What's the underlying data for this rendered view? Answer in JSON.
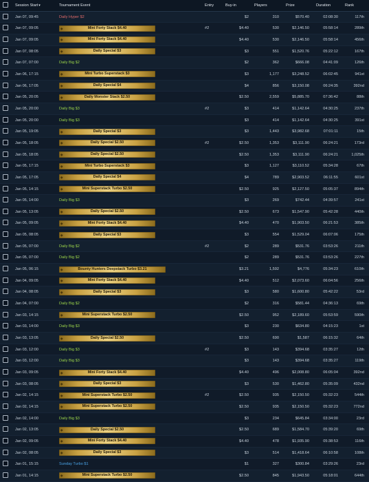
{
  "header": {
    "session_start": "Session Start",
    "tournament_event": "Tournament Event",
    "entry": "Entry",
    "buy_in": "Buy-in",
    "players": "Players",
    "prize": "Prize",
    "duration": "Duration",
    "rank": "Rank"
  },
  "colors": {
    "hyper": "#e06a6a",
    "big": "#9bd44a",
    "sunday": "#4aa3e6",
    "badge_gold": "#d4b04f"
  },
  "rows": [
    {
      "date": "Jan 07, 09:45",
      "event": "Daily Hyper $2",
      "style": "hyper",
      "entry": "",
      "buyin": "$2",
      "players": "310",
      "prize": "$570.40",
      "duration": "02:08:30",
      "rank": "117th"
    },
    {
      "date": "Jan 07, 09:05",
      "event": "Mini Forty Stack $4.40",
      "style": "badge",
      "entry": "#2",
      "buyin": "$4.40",
      "players": "530",
      "prize": "$2,146.50",
      "duration": "05:58:14",
      "rank": "289th"
    },
    {
      "date": "Jan 07, 09:05",
      "event": "Mini Forty Stack $4.40",
      "style": "badge",
      "entry": "",
      "buyin": "$4.40",
      "players": "530",
      "prize": "$2,146.50",
      "duration": "05:58:14",
      "rank": "456th"
    },
    {
      "date": "Jan 07, 08:05",
      "event": "Daily Special $3",
      "style": "badge",
      "entry": "",
      "buyin": "$3",
      "players": "551",
      "prize": "$1,520.76",
      "duration": "05:22:12",
      "rank": "167th"
    },
    {
      "date": "Jan 07, 07:00",
      "event": "Daily Big $2",
      "style": "big",
      "entry": "",
      "buyin": "$2",
      "players": "362",
      "prize": "$666.08",
      "duration": "04:41:09",
      "rank": "126th"
    },
    {
      "date": "Jan 06, 17:15",
      "event": "Mini Turbo Superstack $3",
      "style": "badge",
      "entry": "",
      "buyin": "$3",
      "players": "1,177",
      "prize": "$3,248.52",
      "duration": "06:02:45",
      "rank": "941st"
    },
    {
      "date": "Jan 06, 17:05",
      "event": "Daily Special $4",
      "style": "badge",
      "entry": "",
      "buyin": "$4",
      "players": "856",
      "prize": "$3,150.08",
      "duration": "06:24:35",
      "rank": "392nd"
    },
    {
      "date": "Jan 05, 20:05",
      "event": "Daily Monster Stack $2.50",
      "style": "badge",
      "entry": "",
      "buyin": "$2.50",
      "players": "2,559",
      "prize": "$5,885.70",
      "duration": "07:36:42",
      "rank": "88th"
    },
    {
      "date": "Jan 05, 20:00",
      "event": "Daily Big $3",
      "style": "big",
      "entry": "#2",
      "buyin": "$3",
      "players": "414",
      "prize": "$1,142.64",
      "duration": "04:30:25",
      "rank": "237th"
    },
    {
      "date": "Jan 05, 20:00",
      "event": "Daily Big $3",
      "style": "big",
      "entry": "",
      "buyin": "$3",
      "players": "414",
      "prize": "$1,142.64",
      "duration": "04:30:25",
      "rank": "391st"
    },
    {
      "date": "Jan 05, 19:05",
      "event": "Daily Special $3",
      "style": "badge",
      "entry": "",
      "buyin": "$3",
      "players": "1,443",
      "prize": "$3,982.68",
      "duration": "07:01:11",
      "rank": "15th"
    },
    {
      "date": "Jan 05, 18:05",
      "event": "Daily Special $2.50",
      "style": "badge",
      "entry": "#2",
      "buyin": "$2.50",
      "players": "1,353",
      "prize": "$3,111.90",
      "duration": "06:24:21",
      "rank": "173rd"
    },
    {
      "date": "Jan 05, 18:05",
      "event": "Daily Special $2.50",
      "style": "badge",
      "entry": "",
      "buyin": "$2.50",
      "players": "1,353",
      "prize": "$3,111.90",
      "duration": "06:24:21",
      "rank": "1,025th"
    },
    {
      "date": "Jan 05, 17:15",
      "event": "Mini Turbo Superstack $3",
      "style": "badge",
      "entry": "",
      "buyin": "$3",
      "players": "1,127",
      "prize": "$3,110.52",
      "duration": "05:34:28",
      "rank": "67th"
    },
    {
      "date": "Jan 05, 17:05",
      "event": "Daily Special $4",
      "style": "badge",
      "entry": "",
      "buyin": "$4",
      "players": "789",
      "prize": "$2,903.52",
      "duration": "06:11:55",
      "rank": "601st"
    },
    {
      "date": "Jan 05, 14:15",
      "event": "Mini Superstack Turbo $2.50",
      "style": "badge",
      "entry": "",
      "buyin": "$2.50",
      "players": "925",
      "prize": "$2,127.50",
      "duration": "05:05:37",
      "rank": "894th"
    },
    {
      "date": "Jan 05, 14:00",
      "event": "Daily Big $3",
      "style": "big",
      "entry": "",
      "buyin": "$3",
      "players": "269",
      "prize": "$742.44",
      "duration": "04:39:57",
      "rank": "241st"
    },
    {
      "date": "Jan 05, 13:05",
      "event": "Daily Special $2.50",
      "style": "badge",
      "entry": "",
      "buyin": "$2.50",
      "players": "673",
      "prize": "$1,547.90",
      "duration": "05:42:28",
      "rank": "440th"
    },
    {
      "date": "Jan 05, 09:05",
      "event": "Mini Forty Stack $4.40",
      "style": "badge",
      "entry": "",
      "buyin": "$4.40",
      "players": "470",
      "prize": "$1,903.50",
      "duration": "06:21:53",
      "rank": "385th"
    },
    {
      "date": "Jan 05, 08:05",
      "event": "Daily Special $3",
      "style": "badge",
      "entry": "",
      "buyin": "$3",
      "players": "554",
      "prize": "$1,529.04",
      "duration": "06:07:06",
      "rank": "175th"
    },
    {
      "date": "Jan 05, 07:00",
      "event": "Daily Big $2",
      "style": "big",
      "entry": "#2",
      "buyin": "$2",
      "players": "289",
      "prize": "$531.76",
      "duration": "03:53:26",
      "rank": "211th"
    },
    {
      "date": "Jan 05, 07:00",
      "event": "Daily Big $2",
      "style": "big",
      "entry": "",
      "buyin": "$2",
      "players": "289",
      "prize": "$531.76",
      "duration": "03:53:26",
      "rank": "227th"
    },
    {
      "date": "Jan 05, 06:15",
      "event": "Bounty Hunters Deepstack Turbo $3.21",
      "style": "badge",
      "entry": "",
      "buyin": "$3.21",
      "players": "1,592",
      "prize": "$4,776",
      "duration": "05:34:23",
      "rank": "610th"
    },
    {
      "date": "Jan 04, 09:05",
      "event": "Mini Forty Stack $4.40",
      "style": "badge",
      "entry": "",
      "buyin": "$4.40",
      "players": "512",
      "prize": "$2,073.60",
      "duration": "06:04:56",
      "rank": "256th"
    },
    {
      "date": "Jan 04, 08:05",
      "event": "Daily Special $3",
      "style": "badge",
      "entry": "",
      "buyin": "$3",
      "players": "580",
      "prize": "$1,600.80",
      "duration": "05:42:22",
      "rank": "53rd"
    },
    {
      "date": "Jan 04, 07:00",
      "event": "Daily Big $2",
      "style": "big",
      "entry": "",
      "buyin": "$2",
      "players": "316",
      "prize": "$581.44",
      "duration": "04:36:13",
      "rank": "69th"
    },
    {
      "date": "Jan 03, 14:15",
      "event": "Mini Superstack Turbo $2.50",
      "style": "badge",
      "entry": "",
      "buyin": "$2.50",
      "players": "952",
      "prize": "$2,189.60",
      "duration": "05:53:59",
      "rank": "590th"
    },
    {
      "date": "Jan 03, 14:00",
      "event": "Daily Big $3",
      "style": "big",
      "entry": "",
      "buyin": "$3",
      "players": "230",
      "prize": "$634.80",
      "duration": "04:15:23",
      "rank": "1st"
    },
    {
      "date": "Jan 03, 13:05",
      "event": "Daily Special $2.50",
      "style": "badge",
      "entry": "",
      "buyin": "$2.50",
      "players": "690",
      "prize": "$1,587",
      "duration": "06:15:32",
      "rank": "64th"
    },
    {
      "date": "Jan 03, 12:00",
      "event": "Daily Big $3",
      "style": "big",
      "entry": "#2",
      "buyin": "$3",
      "players": "143",
      "prize": "$394.68",
      "duration": "03:35:27",
      "rank": "12th"
    },
    {
      "date": "Jan 03, 12:00",
      "event": "Daily Big $3",
      "style": "big",
      "entry": "",
      "buyin": "$3",
      "players": "143",
      "prize": "$394.68",
      "duration": "03:35:27",
      "rank": "119th"
    },
    {
      "date": "Jan 03, 09:05",
      "event": "Mini Forty Stack $4.40",
      "style": "badge",
      "entry": "",
      "buyin": "$4.40",
      "players": "496",
      "prize": "$2,008.80",
      "duration": "06:05:04",
      "rank": "392nd"
    },
    {
      "date": "Jan 03, 08:05",
      "event": "Daily Special $3",
      "style": "badge",
      "entry": "",
      "buyin": "$3",
      "players": "530",
      "prize": "$1,462.80",
      "duration": "05:35:09",
      "rank": "432nd"
    },
    {
      "date": "Jan 02, 14:15",
      "event": "Mini Superstack Turbo $2.50",
      "style": "badge",
      "entry": "#2",
      "buyin": "$2.50",
      "players": "935",
      "prize": "$2,150.50",
      "duration": "05:32:23",
      "rank": "544th"
    },
    {
      "date": "Jan 02, 14:15",
      "event": "Mini Superstack Turbo $2.50",
      "style": "badge",
      "entry": "",
      "buyin": "$2.50",
      "players": "935",
      "prize": "$2,150.50",
      "duration": "05:32:23",
      "rank": "772nd"
    },
    {
      "date": "Jan 02, 14:00",
      "event": "Daily Big $3",
      "style": "big",
      "entry": "",
      "buyin": "$3",
      "players": "234",
      "prize": "$645.84",
      "duration": "03:34:00",
      "rank": "23rd"
    },
    {
      "date": "Jan 02, 13:05",
      "event": "Daily Special $2.50",
      "style": "badge",
      "entry": "",
      "buyin": "$2.50",
      "players": "689",
      "prize": "$1,584.70",
      "duration": "05:39:20",
      "rank": "69th"
    },
    {
      "date": "Jan 02, 09:05",
      "event": "Mini Forty Stack $4.40",
      "style": "badge",
      "entry": "",
      "buyin": "$4.40",
      "players": "478",
      "prize": "$1,935.90",
      "duration": "05:38:53",
      "rank": "116th"
    },
    {
      "date": "Jan 02, 08:05",
      "event": "Daily Special $3",
      "style": "badge",
      "entry": "",
      "buyin": "$3",
      "players": "514",
      "prize": "$1,418.64",
      "duration": "06:10:58",
      "rank": "108th"
    },
    {
      "date": "Jan 01, 15:15",
      "event": "Sunday Turbo $1",
      "style": "sunday",
      "entry": "",
      "buyin": "$1",
      "players": "327",
      "prize": "$300.84",
      "duration": "03:29:26",
      "rank": "23rd"
    },
    {
      "date": "Jan 01, 14:15",
      "event": "Mini Superstack Turbo $2.50",
      "style": "badge",
      "entry": "",
      "buyin": "$2.50",
      "players": "845",
      "prize": "$1,943.50",
      "duration": "05:18:01",
      "rank": "644th"
    }
  ]
}
